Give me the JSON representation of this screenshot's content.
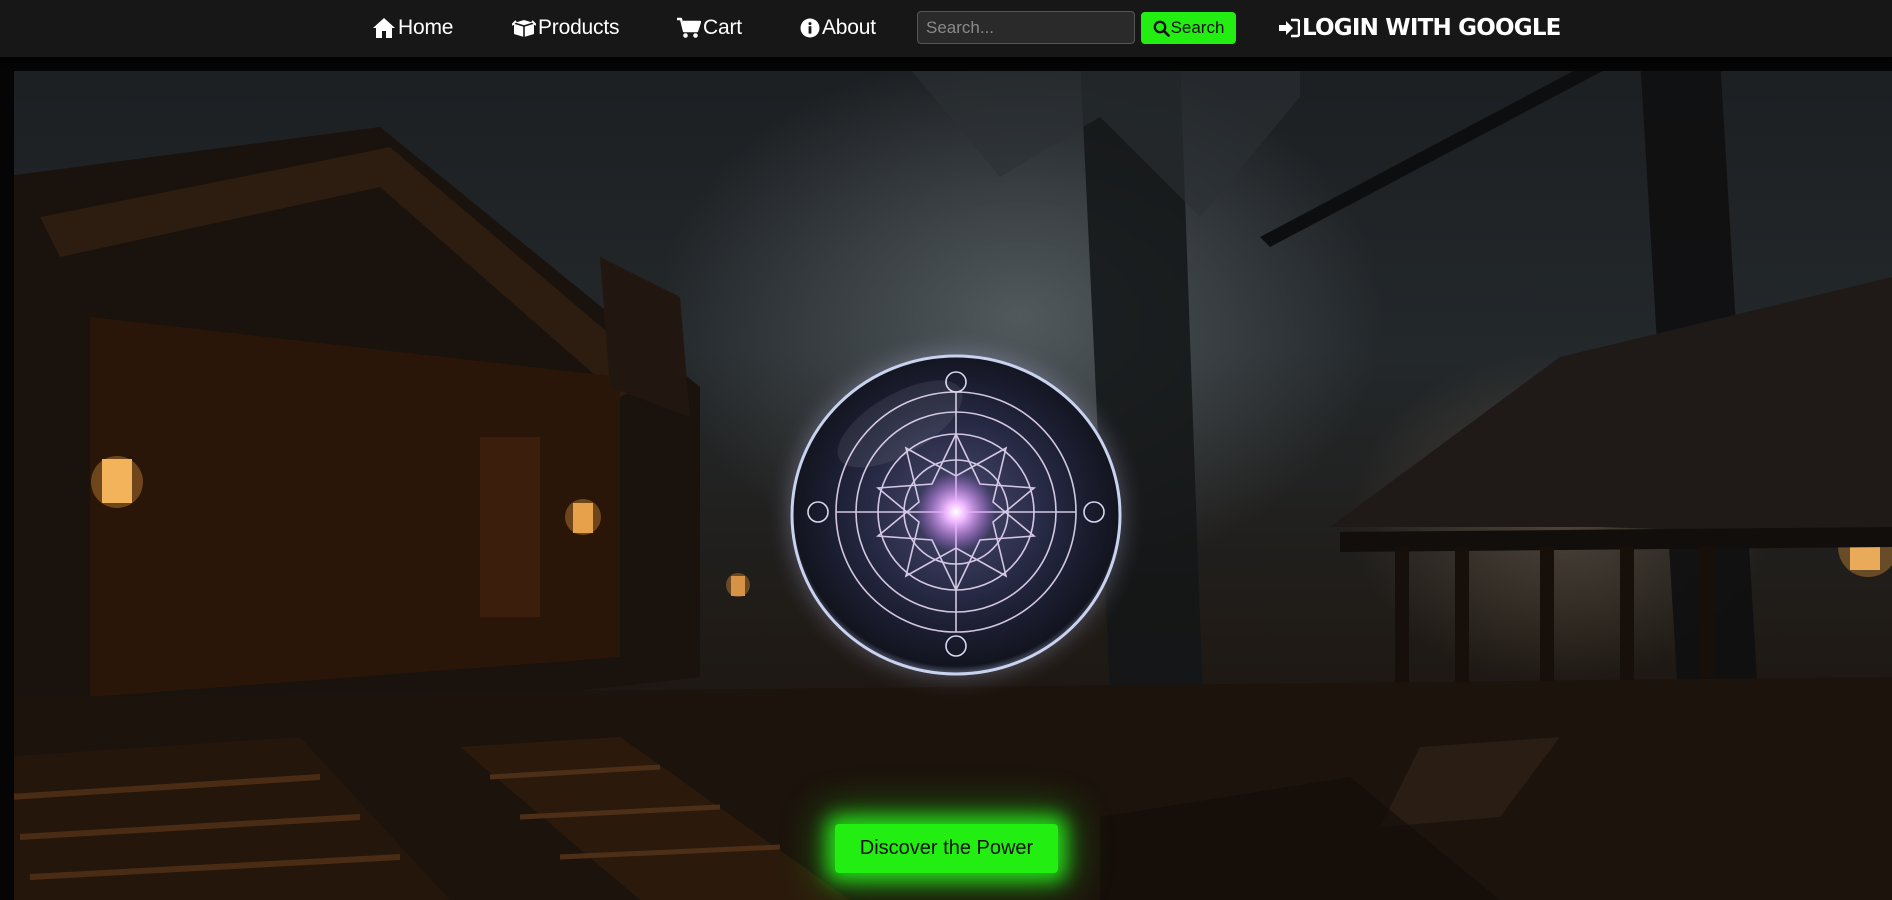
{
  "nav": {
    "home_label": "Home",
    "products_label": "Products",
    "cart_label": "Cart",
    "about_label": "About",
    "search_placeholder": "Search...",
    "search_button_label": "Search",
    "login_label": "LOGIN WITH GOOGLE"
  },
  "hero": {
    "cta_label": "Discover the Power"
  },
  "icons": {
    "home": "home-icon",
    "products": "box-icon",
    "cart": "cart-icon",
    "about": "info-icon",
    "search": "search-icon",
    "login": "sign-in-icon"
  },
  "colors": {
    "accent": "#22ee11",
    "navbar_bg": "#171717",
    "nav_text": "#ffffff"
  }
}
